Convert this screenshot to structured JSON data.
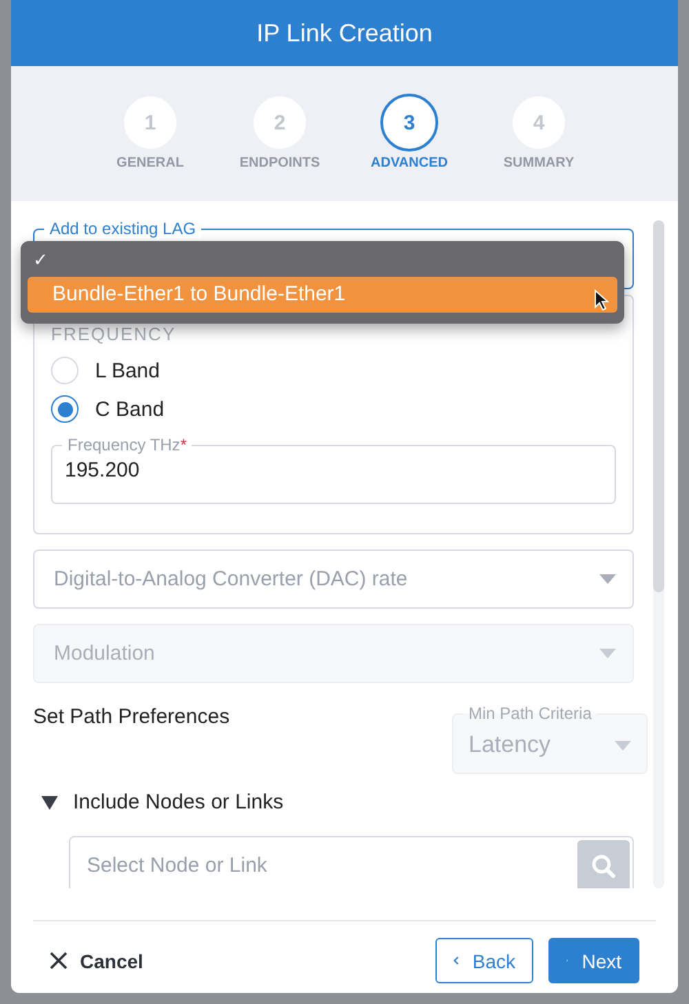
{
  "dialog": {
    "title": "IP Link Creation"
  },
  "steps": [
    {
      "number": "1",
      "label": "GENERAL",
      "selected": false
    },
    {
      "number": "2",
      "label": "ENDPOINTS",
      "selected": false
    },
    {
      "number": "3",
      "label": "ADVANCED",
      "selected": true
    },
    {
      "number": "4",
      "label": "SUMMARY",
      "selected": false
    }
  ],
  "lag": {
    "label": "Add to existing LAG",
    "check": "✓",
    "options": [
      {
        "label": "Bundle-Ether1 to Bundle-Ether1",
        "highlighted": true
      }
    ]
  },
  "frequency": {
    "legend": "FREQUENCY",
    "bands": [
      {
        "label": "L Band",
        "selected": false
      },
      {
        "label": "C Band",
        "selected": true
      }
    ],
    "field": {
      "label": "Frequency THz",
      "required_mark": "*",
      "value": "195.200"
    }
  },
  "dac": {
    "placeholder": "Digital-to-Analog Converter (DAC) rate",
    "disabled": false
  },
  "modulation": {
    "placeholder": "Modulation",
    "disabled": true
  },
  "path": {
    "title": "Set Path Preferences",
    "criteria": {
      "label": "Min Path Criteria",
      "value": "Latency",
      "disabled": true
    }
  },
  "include": {
    "label": "Include Nodes or Links",
    "expanded": true,
    "search": {
      "placeholder": "Select Node or Link"
    }
  },
  "footer": {
    "cancel": "Cancel",
    "back": "Back",
    "next": "Next"
  }
}
